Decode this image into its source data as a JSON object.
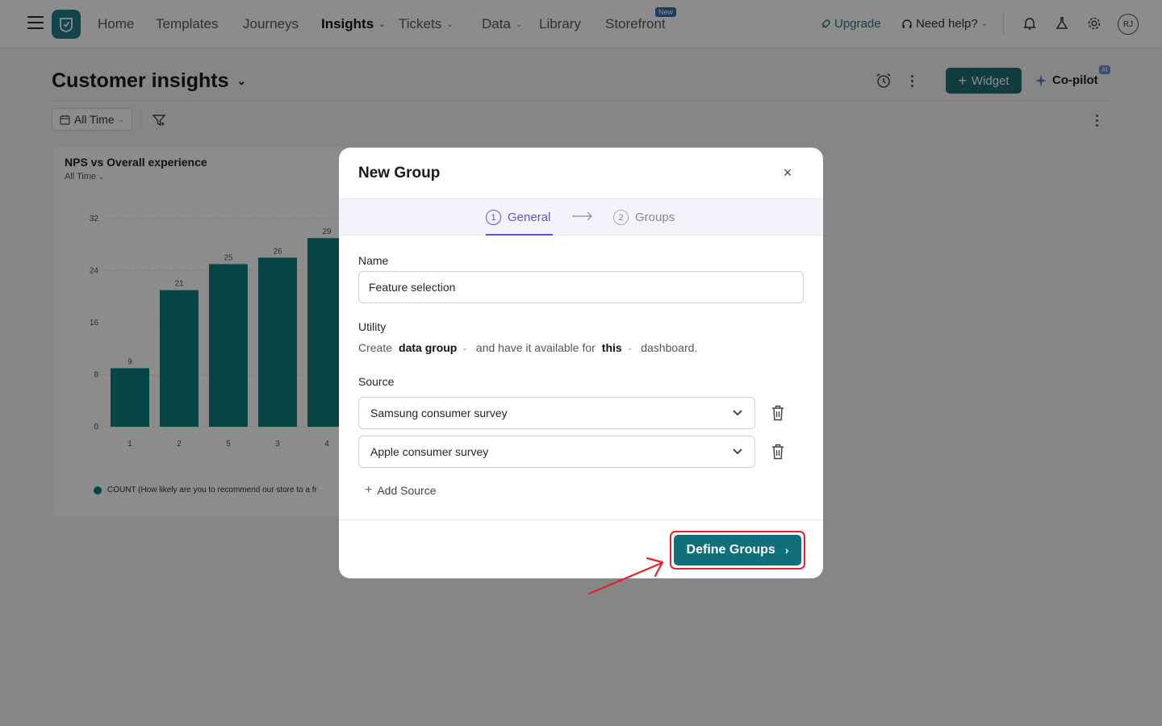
{
  "nav": {
    "items": [
      {
        "label": "Home"
      },
      {
        "label": "Templates"
      },
      {
        "label": "Journeys"
      },
      {
        "label": "Insights"
      },
      {
        "label": "Tickets"
      },
      {
        "label": "Data"
      },
      {
        "label": "Library"
      },
      {
        "label": "Storefront"
      }
    ],
    "new_badge": "New",
    "upgrade": "Upgrade",
    "need_help": "Need help?",
    "avatar_initials": "RJ"
  },
  "page": {
    "title": "Customer insights",
    "widget_label": "Widget",
    "copilot_label": "Co-pilot",
    "ai_badge": "AI",
    "date_filter": "All Time"
  },
  "chart_card": {
    "title": "NPS vs Overall experience",
    "subtitle": "All Time",
    "legend": "COUNT (How likely are you to recommend our store to a fr"
  },
  "chart_data": {
    "type": "bar",
    "title": "NPS vs Overall experience",
    "categories": [
      "1",
      "2",
      "5",
      "3",
      "4"
    ],
    "values": [
      9,
      21,
      25,
      26,
      29
    ],
    "yticks": [
      "0",
      "8",
      "16",
      "24",
      "32"
    ],
    "ylim": [
      0,
      32
    ],
    "bar_color": "#0d7d7c",
    "grid": true,
    "legend_position": "bottom",
    "series": [
      {
        "name": "COUNT (How likely are you to recommend our store to a fr",
        "values": [
          9,
          21,
          25,
          26,
          29
        ]
      }
    ]
  },
  "modal": {
    "title": "New Group",
    "steps": [
      {
        "num": "1",
        "label": "General"
      },
      {
        "num": "2",
        "label": "Groups"
      }
    ],
    "name_label": "Name",
    "name_value": "Feature selection",
    "utility_label": "Utility",
    "utility": {
      "create": "Create",
      "type": "data group",
      "middle": "and have it available for",
      "scope": "this",
      "end": "dashboard."
    },
    "source_label": "Source",
    "sources": [
      "Samsung consumer survey",
      "Apple consumer survey"
    ],
    "add_source": "Add Source",
    "primary_button": "Define Groups"
  },
  "colors": {
    "accent": "#1f6f76",
    "step_active": "#6b4fd0",
    "highlight": "#e0242b"
  }
}
